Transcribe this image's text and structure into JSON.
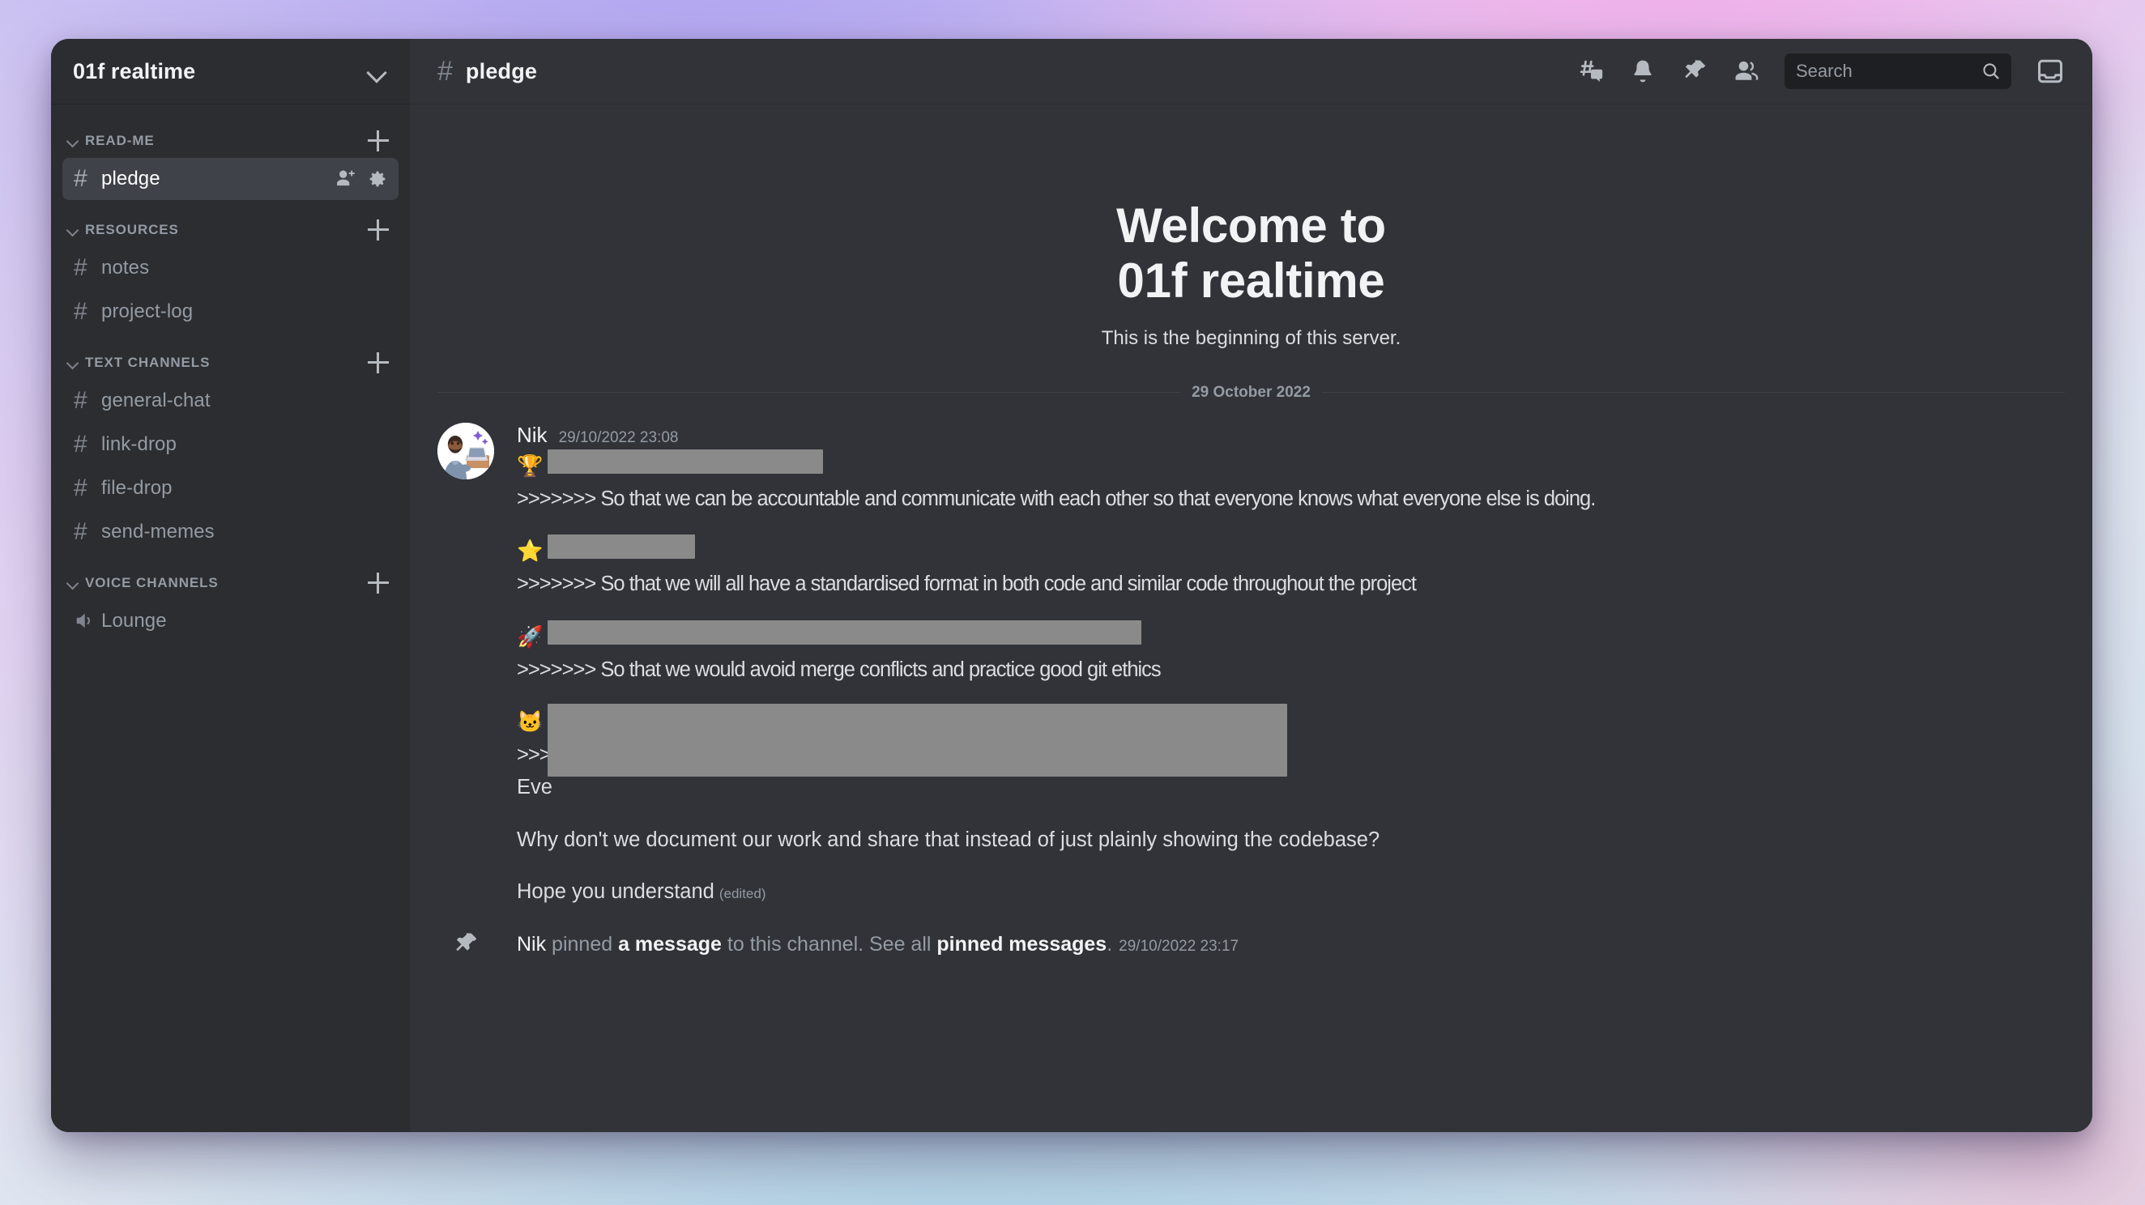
{
  "window": {
    "background_gradient": [
      "#cdc4f2",
      "#e2d2f2",
      "#dfe6f0",
      "#cfe0ec"
    ],
    "accent_purple": "#a79bf0",
    "accent_pink": "#f2a9e8"
  },
  "sidebar": {
    "server_name": "01f realtime",
    "server_dropdown_icon": "chevron-down-icon",
    "categories": [
      {
        "label": "READ-ME",
        "add_icon": "plus-icon",
        "collapse_icon": "chevron-down-icon",
        "channels": [
          {
            "name": "pledge",
            "icon": "hash-icon",
            "active": true,
            "actions": [
              "add-member-icon",
              "gear-icon"
            ]
          }
        ]
      },
      {
        "label": "RESOURCES",
        "add_icon": "plus-icon",
        "collapse_icon": "chevron-down-icon",
        "channels": [
          {
            "name": "notes",
            "icon": "hash-icon",
            "active": false,
            "actions": []
          },
          {
            "name": "project-log",
            "icon": "hash-icon",
            "active": false,
            "actions": []
          }
        ]
      },
      {
        "label": "TEXT CHANNELS",
        "add_icon": "plus-icon",
        "collapse_icon": "chevron-down-icon",
        "channels": [
          {
            "name": "general-chat",
            "icon": "hash-icon",
            "active": false,
            "actions": []
          },
          {
            "name": "link-drop",
            "icon": "hash-icon",
            "active": false,
            "actions": []
          },
          {
            "name": "file-drop",
            "icon": "hash-icon",
            "active": false,
            "actions": []
          },
          {
            "name": "send-memes",
            "icon": "hash-icon",
            "active": false,
            "actions": []
          }
        ]
      },
      {
        "label": "VOICE CHANNELS",
        "add_icon": "plus-icon",
        "collapse_icon": "chevron-down-icon",
        "channels": [
          {
            "name": "Lounge",
            "icon": "speaker-icon",
            "active": false,
            "actions": []
          }
        ]
      }
    ]
  },
  "topbar": {
    "channel_hash": "#",
    "channel_name": "pledge",
    "icons": [
      "threads-icon",
      "bell-icon",
      "pin-icon",
      "members-icon"
    ],
    "search": {
      "placeholder": "Search",
      "value": "",
      "icon": "search-icon"
    },
    "inbox_icon": "inbox-icon"
  },
  "main": {
    "welcome": {
      "line1": "Welcome to",
      "line2": "01f realtime",
      "subtitle": "This is the beginning of this server."
    },
    "date_divider": "29 October 2022",
    "message_group": {
      "author": "Nik",
      "timestamp": "29/10/2022 23:08",
      "avatar_icon": "user-avatar-technologist",
      "blocks": [
        {
          "emoji": "🏆",
          "emoji_name": "trophy-emoji",
          "redacted": true,
          "redact_width": 340,
          "reply": ">>>>>>> So that we can be accountable and communicate with each other so that everyone knows what everyone else is doing."
        },
        {
          "emoji": "⭐",
          "emoji_name": "star-emoji",
          "redacted": true,
          "redact_width": 182,
          "reply": ">>>>>>> So that we will all have a standardised format in both code and similar code throughout the project"
        },
        {
          "emoji": "🚀",
          "emoji_name": "rocket-emoji",
          "redacted": true,
          "redact_width": 733,
          "reply": ">>>>>>> So that we would avoid merge conflicts and practice good git ethics"
        },
        {
          "emoji": "🐱",
          "emoji_name": "cat-emoji",
          "redacted": true,
          "redact_width": 913,
          "partial_line2": ">>>",
          "partial_line3": "Eve"
        }
      ],
      "closing_lines": [
        {
          "text": "Why don't we document our work and share that instead of just plainly showing the codebase?",
          "edited": false
        },
        {
          "text": "Hope you understand",
          "edited": true,
          "edited_label": "(edited)"
        }
      ]
    },
    "pinned_system_message": {
      "icon": "pin-icon",
      "author": "Nik",
      "verb": " pinned ",
      "target": "a message",
      "middle": " to this channel. See all ",
      "link": "pinned messages",
      "period": ".",
      "timestamp": "29/10/2022 23:17"
    }
  }
}
